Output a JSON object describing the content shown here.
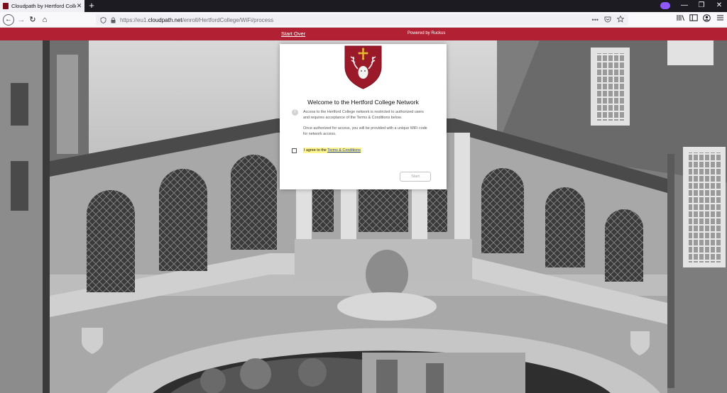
{
  "browser": {
    "tab_title": "Cloudpath by Hertford College",
    "tab_close": "✕",
    "new_tab": "+",
    "url_prefix": "https://eu1.",
    "url_domain": "cloudpath.net",
    "url_path": "/enroll/HertfordCollege/WiFi/process",
    "url_more": "•••",
    "minimize": "—",
    "restore": "❐",
    "close": "✕",
    "back": "←",
    "forward": "→",
    "reload": "↻",
    "home": "⌂"
  },
  "portal": {
    "start_over": "Start Over",
    "powered_by": "Powered by Ruckus"
  },
  "modal": {
    "title": "Welcome to the Hertford College Network",
    "paragraph1": "Access to the Hertford College network is restricted to authorized users and requires acceptance of the Terms & Conditions below.",
    "paragraph2": "Once authorized for access, you will be provided with a unique WiFi code for network access.",
    "agree_prefix": "I agree to the ",
    "terms_link": "Terms & Conditions",
    "agree_checked": false,
    "start_button": "Start",
    "info_icon": "!"
  },
  "colors": {
    "portal_bar": "#b22033",
    "crest": "#9a1a2a",
    "modal_bg": "#ffffff"
  },
  "icons": [
    "firefox-tab-favicon",
    "shield-icon",
    "lock-icon",
    "pocket-icon",
    "star-icon",
    "library-icon",
    "sidebar-icon",
    "account-icon",
    "menu-icon",
    "extension-icon",
    "info-icon",
    "crest-logo"
  ]
}
